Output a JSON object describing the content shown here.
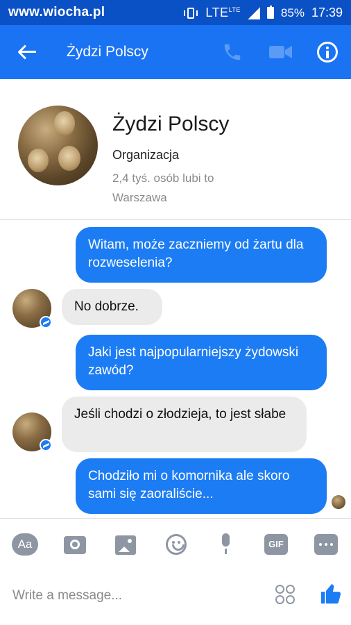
{
  "watermark": "www.wiocha.pl",
  "status_bar": {
    "network": "LTE",
    "network_sup": "LTE",
    "battery": "85%",
    "time": "17:39"
  },
  "header": {
    "title": "Żydzi Polscy",
    "back_icon": "back-arrow-icon",
    "call_icon": "phone-icon",
    "video_icon": "video-camera-icon",
    "info_icon": "info-icon"
  },
  "profile": {
    "name": "Żydzi Polscy",
    "category": "Organizacja",
    "likes": "2,4 tyś. osób lubi to",
    "city": "Warszawa"
  },
  "messages": [
    {
      "from": "me",
      "text": "Witam, może zaczniemy od żartu dla rozweselenia?"
    },
    {
      "from": "them",
      "text": "No dobrze."
    },
    {
      "from": "me",
      "text": "Jaki jest najpopularniejszy żydowski zawód?"
    },
    {
      "from": "them",
      "text": "Jeśli chodzi o złodzieja, to jest słabe"
    },
    {
      "from": "me",
      "text": "Chodziło mi o komornika ale skoro sami się zaoraliście..."
    }
  ],
  "toolbar": {
    "text_label": "Aa",
    "gif_label": "GIF"
  },
  "composer": {
    "placeholder": "Write a message..."
  },
  "colors": {
    "accent": "#1a73f3",
    "status_bar": "#0b51c6",
    "outgoing_bubble": "#1c7cf4",
    "incoming_bubble": "#ebebeb",
    "icon_gray": "#8e96a3"
  }
}
